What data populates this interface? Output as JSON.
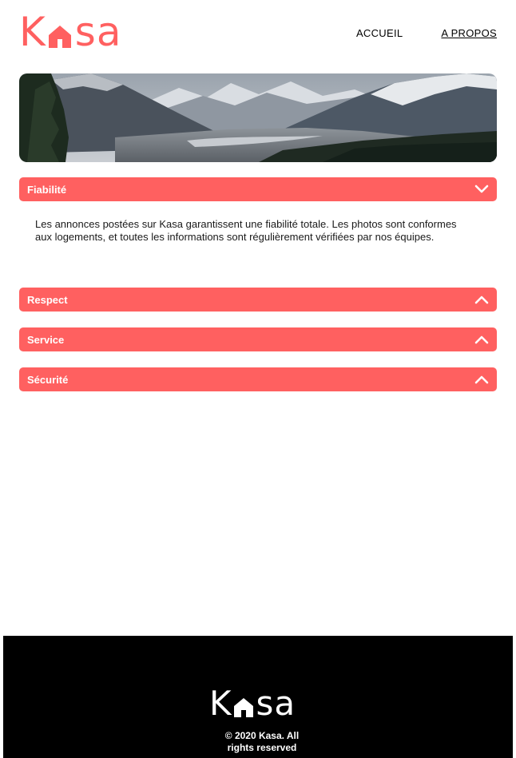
{
  "colors": {
    "brand": "#ff6060",
    "footer_bg": "#000000",
    "footer_text": "#ffffff",
    "text": "#000000"
  },
  "header": {
    "logo": {
      "letter_left": "K",
      "letters_right": "sa",
      "icon": "house-icon"
    },
    "nav": [
      {
        "label": "ACCUEIL",
        "active": false
      },
      {
        "label": "A PROPOS",
        "active": true
      }
    ]
  },
  "banner": {
    "icon": "mountain-landscape-image"
  },
  "sections": [
    {
      "title": "Fiabilité",
      "expanded": true,
      "chevron": "chevron-down-icon",
      "body": "Les annonces postées sur Kasa garantissent une fiabilité totale. Les photos sont conformes aux logements, et toutes les informations sont régulièrement vérifiées par nos équipes."
    },
    {
      "title": "Respect",
      "expanded": false,
      "chevron": "chevron-up-icon"
    },
    {
      "title": "Service",
      "expanded": false,
      "chevron": "chevron-up-icon"
    },
    {
      "title": "Sécurité",
      "expanded": false,
      "chevron": "chevron-up-icon"
    }
  ],
  "footer": {
    "logo": {
      "letter_left": "K",
      "letters_right": "sa",
      "icon": "house-icon"
    },
    "copyright_line1": "© 2020 Kasa. All",
    "copyright_line2": "rights reserved"
  }
}
